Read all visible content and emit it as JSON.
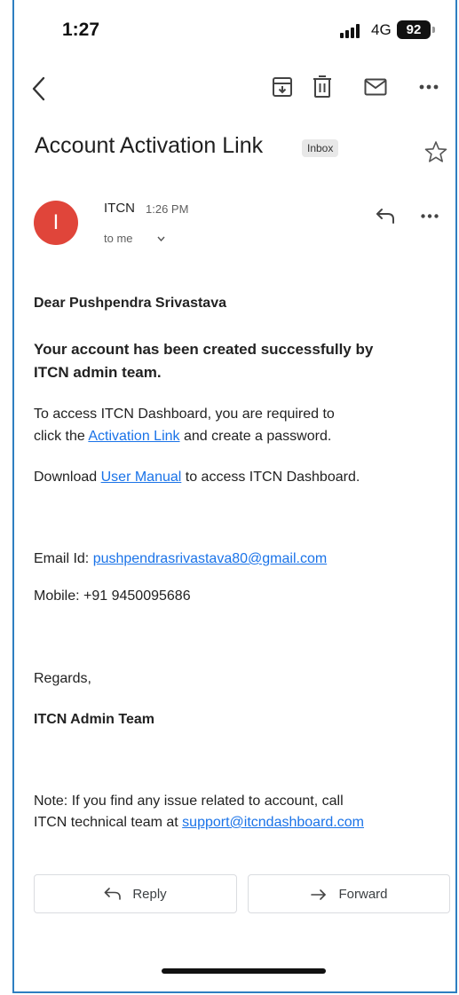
{
  "status_bar": {
    "time": "1:27",
    "network": "4G",
    "battery": "92"
  },
  "toolbar": {
    "icons": [
      "back-icon",
      "archive-icon",
      "trash-icon",
      "mail-icon",
      "more-icon"
    ]
  },
  "email": {
    "subject": "Account Activation Link",
    "label": "Inbox",
    "sender": {
      "initial": "I",
      "name": "ITCN",
      "time": "1:26 PM",
      "recipient": "to me"
    },
    "body": {
      "greeting": "Dear Pushpendra Srivastava",
      "created_line1": "Your account has been created successfully by",
      "created_line2": "ITCN admin team.",
      "access_line1": "To access ITCN Dashboard, you are required to",
      "access_line2_pre": "click the ",
      "activation_link": "Activation Link",
      "access_line2_post": " and create a password.",
      "download_pre": "Download ",
      "user_manual_link": "User Manual",
      "download_post": " to access ITCN Dashboard.",
      "email_label": "Email Id: ",
      "email_value": "pushpendrasrivastava80@gmail.com",
      "mobile": "Mobile: +91 9450095686",
      "regards": "Regards,",
      "signature": "ITCN Admin Team",
      "note_line1": "Note: If you find any issue related to account, call",
      "note_line2_pre": "ITCN technical team at ",
      "support_email": "support@itcndashboard.com"
    }
  },
  "actions": {
    "reply_label": "Reply",
    "forward_label": "Forward"
  },
  "colors": {
    "frame": "#2e7fc1",
    "avatar": "#e0453a",
    "link": "#1a73e8"
  }
}
